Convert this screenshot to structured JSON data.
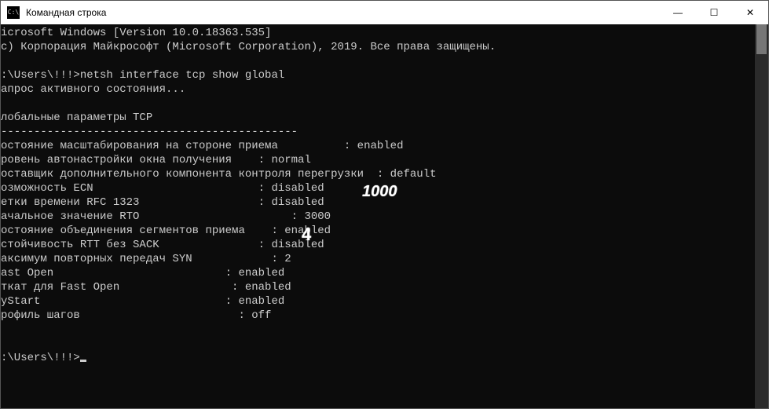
{
  "titlebar": {
    "icon_text": "C:\\",
    "title": "Командная строка"
  },
  "controls": {
    "minimize": "—",
    "maximize": "☐",
    "close": "✕"
  },
  "annotations": {
    "a1": "1000",
    "a2": "4"
  },
  "terminal": {
    "lines": [
      "icrosoft Windows [Version 10.0.18363.535]",
      "с) Корпорация Майкрософт (Microsoft Corporation), 2019. Все права защищены.",
      "",
      ":\\Users\\!!!>netsh interface tcp show global",
      "апрос активного состояния...",
      "",
      "лобальные параметры TCP",
      "---------------------------------------------",
      "остояние масштабирования на стороне приема          : enabled",
      "ровень автонастройки окна получения    : normal",
      "оставщик дополнительного компонента контроля перегрузки  : default",
      "озможность ECN                         : disabled",
      "етки времени RFC 1323                  : disabled",
      "ачальное значение RTO                       : 3000",
      "остояние объединения сегментов приема    : enabled",
      "стойчивость RTT без SACK               : disabled",
      "аксимум повторных передач SYN            : 2",
      "ast Open                          : enabled",
      "ткат для Fast Open                 : enabled",
      "yStart                            : enabled",
      "рофиль шагов                        : off",
      "",
      "",
      ":\\Users\\!!!>"
    ]
  }
}
